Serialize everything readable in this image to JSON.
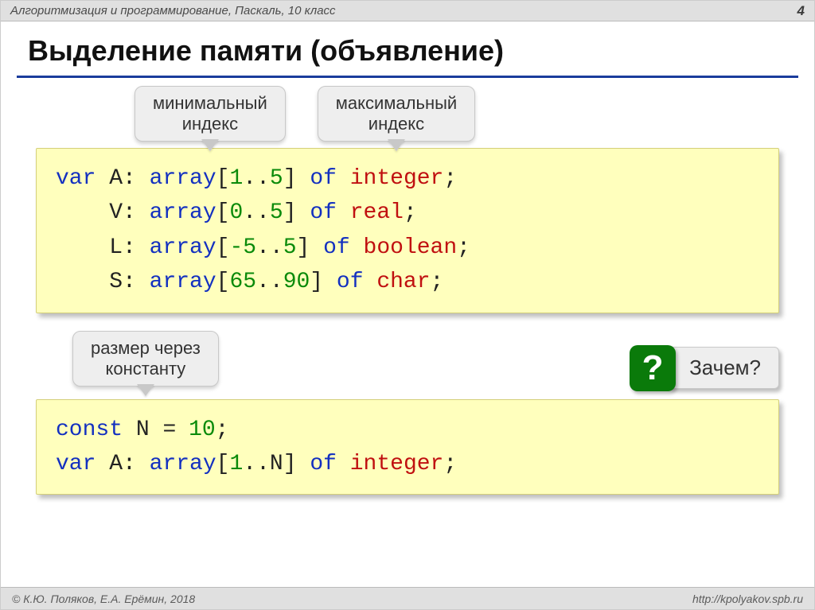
{
  "header": {
    "breadcrumb": "Алгоритмизация и программирование, Паскаль, 10 класс",
    "page_number": "4"
  },
  "title": "Выделение памяти (объявление)",
  "callouts": {
    "min_index": "минимальный\nиндекс",
    "max_index": "максимальный\nиндекс",
    "size_const": "размер через\nконстанту"
  },
  "code1": {
    "l1": {
      "kw": "var",
      "name": " A: ",
      "arr": "array",
      "lb": "[",
      "lo": "1",
      "dots": "..",
      "hi": "5",
      "rb": "] ",
      "of": "of",
      "sp": " ",
      "type": "integer",
      "semi": ";"
    },
    "l2": {
      "pad": "    ",
      "name": "V: ",
      "arr": "array",
      "lb": "[",
      "lo": "0",
      "dots": "..",
      "hi": "5",
      "rb": "] ",
      "of": "of",
      "sp": " ",
      "type": "real",
      "semi": ";"
    },
    "l3": {
      "pad": "    ",
      "name": "L: ",
      "arr": "array",
      "lb": "[",
      "lo": "-5",
      "dots": "..",
      "hi": "5",
      "rb": "] ",
      "of": "of",
      "sp": " ",
      "type": "boolean",
      "semi": ";"
    },
    "l4": {
      "pad": "    ",
      "name": "S: ",
      "arr": "array",
      "lb": "[",
      "lo": "65",
      "dots": "..",
      "hi": "90",
      "rb": "] ",
      "of": "of",
      "sp": " ",
      "type": "char",
      "semi": ";"
    }
  },
  "why": {
    "mark": "?",
    "label": "Зачем?"
  },
  "code2": {
    "l1": {
      "kw": "const",
      "name": " N ",
      "eq": "=",
      "sp": " ",
      "val": "10",
      "semi": ";"
    },
    "l2": {
      "kw": "var",
      "name": " A: ",
      "arr": "array",
      "lb": "[",
      "lo": "1",
      "dots": "..",
      "hi": "N",
      "rb": "] ",
      "of": "of",
      "sp": " ",
      "type": "integer",
      "semi": ";"
    }
  },
  "footer": {
    "copyright": "© К.Ю. Поляков, Е.А. Ерёмин, 2018",
    "url": "http://kpolyakov.spb.ru"
  }
}
